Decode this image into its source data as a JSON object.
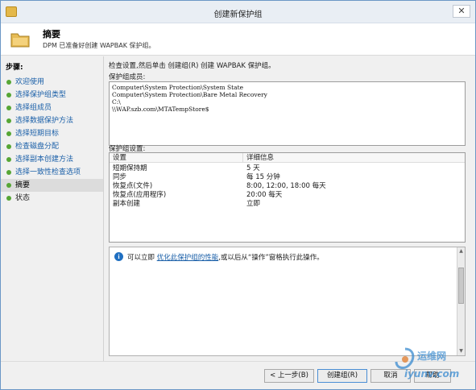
{
  "window": {
    "title": "创建新保护组",
    "close_glyph": "✕"
  },
  "header": {
    "title": "摘要",
    "description": "DPM 已准备好创建 WAPBAK 保护组。"
  },
  "sidebar": {
    "steps_label": "步骤:",
    "items": [
      {
        "label": "欢迎使用",
        "state": "done"
      },
      {
        "label": "选择保护组类型",
        "state": "done"
      },
      {
        "label": "选择组成员",
        "state": "done"
      },
      {
        "label": "选择数据保护方法",
        "state": "done"
      },
      {
        "label": "选择短期目标",
        "state": "done"
      },
      {
        "label": "检查磁盘分配",
        "state": "done"
      },
      {
        "label": "选择副本创建方法",
        "state": "done"
      },
      {
        "label": "选择一致性检查选项",
        "state": "done"
      },
      {
        "label": "摘要",
        "state": "active"
      },
      {
        "label": "状态",
        "state": "pending"
      }
    ]
  },
  "main": {
    "instruction": "检查设置,然后单击 创建组(R) 创建 WAPBAK 保护组。",
    "members_label": "保护组成员:",
    "members": [
      "Computer\\System Protection\\System State",
      "Computer\\System Protection\\Bare Metal Recovery",
      "C:\\",
      "\\\\WAP.szb.com\\MTATempStore$"
    ],
    "settings_label": "保护组设置:",
    "settings_columns": [
      "设置",
      "详细信息"
    ],
    "settings_rows": [
      {
        "setting": "短期保持期",
        "detail": "5 天"
      },
      {
        "setting": "同步",
        "detail": "每 15 分钟"
      },
      {
        "setting": "恢复点(文件)",
        "detail": "8:00, 12:00, 18:00 每天"
      },
      {
        "setting": "恢复点(应用程序)",
        "detail": "20:00 每天"
      },
      {
        "setting": "副本创建",
        "detail": "立即"
      }
    ],
    "info": {
      "prefix": "可以立即",
      "link": "优化此保护组的性能",
      "suffix": ",或以后从“操作”窗格执行此操作。"
    }
  },
  "footer": {
    "back_label": "< 上一步(B)",
    "create_label": "创建组(R)",
    "cancel_label": "取消",
    "help_label": "帮助"
  },
  "watermark": {
    "text": "运维网",
    "sub": "iyunv.com"
  },
  "colors": {
    "accent": "#1a5fa8",
    "step_dot": "#56a635",
    "info_icon": "#1f6fc1"
  }
}
